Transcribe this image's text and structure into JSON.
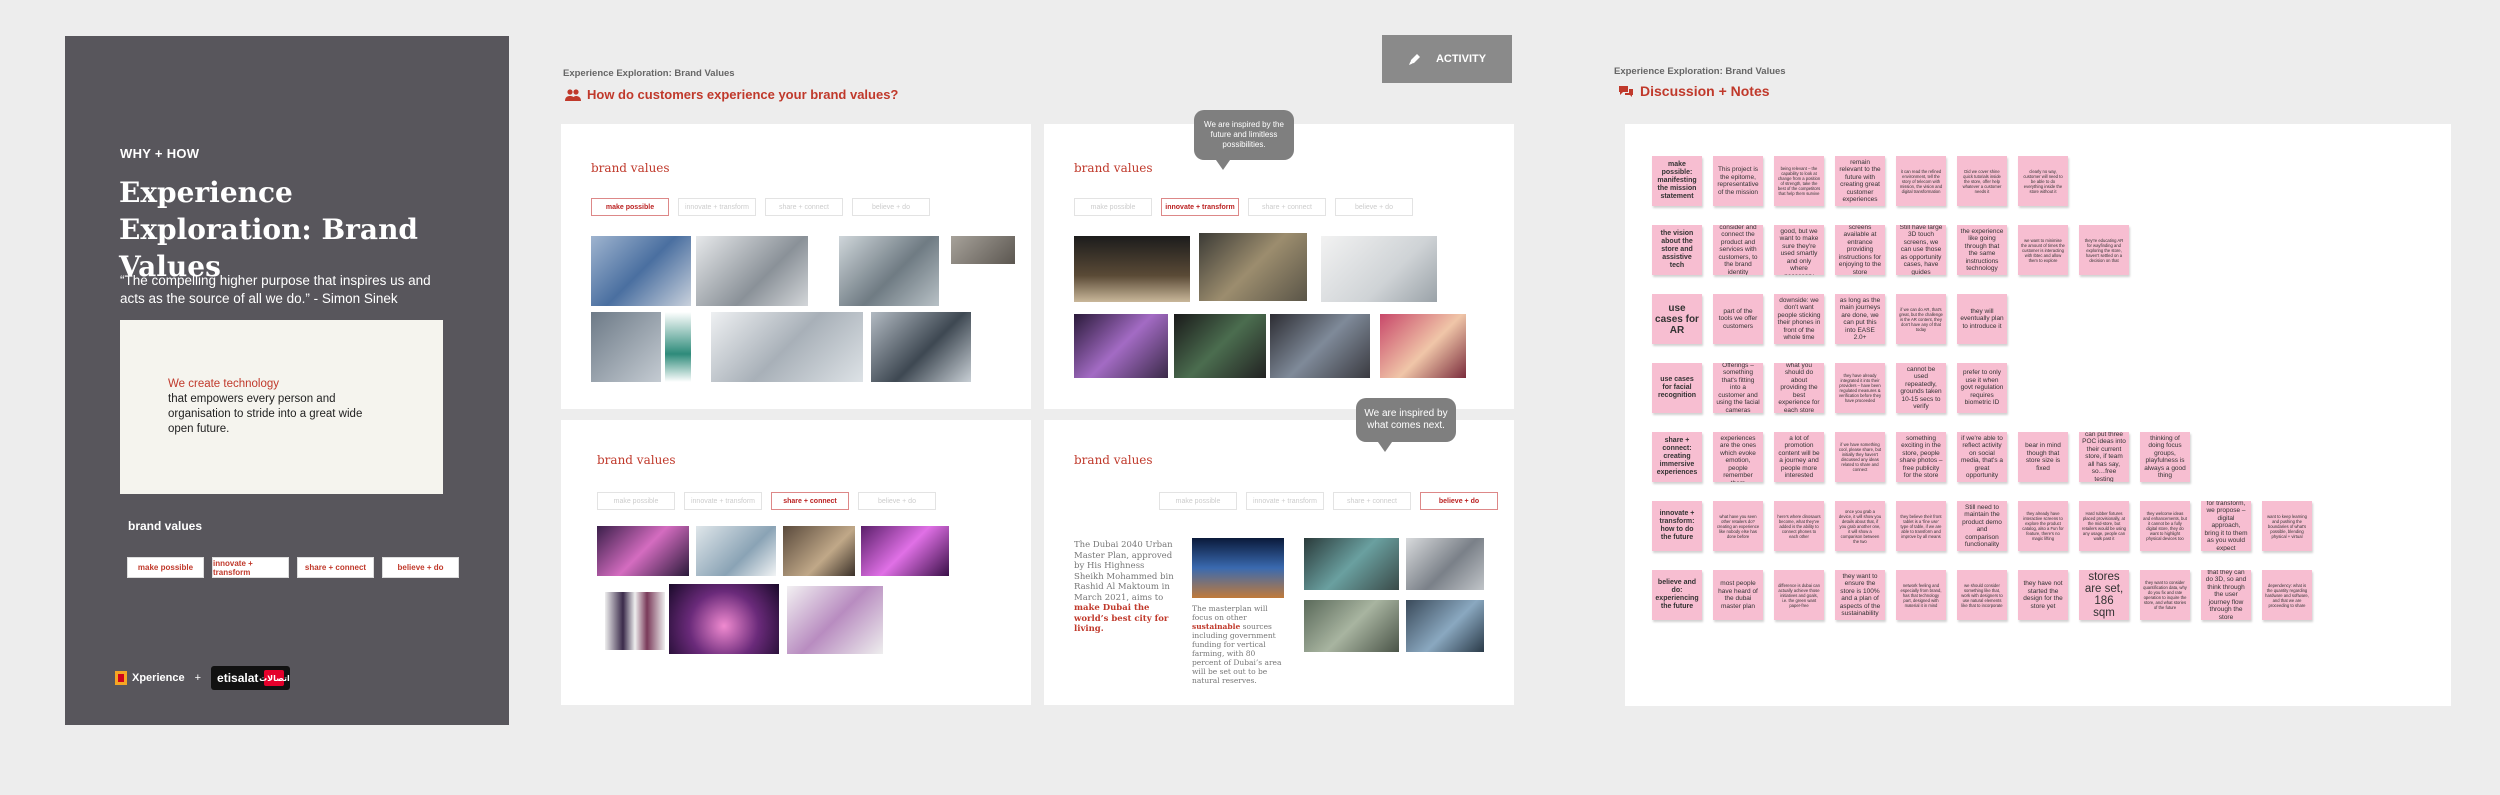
{
  "left_panel": {
    "eyebrow": "WHY + HOW",
    "title": "Experience Exploration: Brand Values",
    "quote": "“The compelling higher purpose that inspires us and acts as the source of all we do.” - Simon Sinek",
    "card_highlight": "We create technology",
    "card_text": "that empowers every person and organisation to stride into a great wide open future.",
    "brand_values_label": "brand values",
    "pills": [
      "make possible",
      "innovate + transform",
      "share + connect",
      "believe + do"
    ],
    "logo_xperience": "Xperience",
    "logo_plus": "+",
    "logo_etisalat": "etisalat",
    "logo_etisalat_ar": "اتصالات"
  },
  "middle": {
    "crumb": "Experience Exploration: Brand Values",
    "heading": "How do customers experience your brand values?",
    "activity_label": "ACTIVITY",
    "card_title": "brand values",
    "pills": [
      "make possible",
      "innovate + transform",
      "share + connect",
      "believe + do"
    ],
    "tooltip_1": "We are inspired by the future and limitless possibilities.",
    "tooltip_2": "We are inspired by what comes next.",
    "text_a_pre": "The Dubai 2040 Urban Master Plan, approved by His Highness Sheikh Mohammed bin Rashid Al Maktoum in March 2021, aims to ",
    "text_a_hl": "make Dubai the world’s best city for living.",
    "text_b_pre": "The masterplan will focus on other ",
    "text_b_hl": "sustainable",
    "text_b_post": " sources including government funding for vertical farming, with 80 percent of Dubai’s area will be set out to be natural reserves."
  },
  "right": {
    "crumb": "Experience Exploration: Brand Values",
    "heading": "Discussion + Notes"
  },
  "board": {
    "rows": [
      {
        "label": "make possible: manifesting the mission statement",
        "notes": [
          "This project is the epitome, representative of the mission",
          "being relevant – the capability to look at change from a position of strength, take the best of the competitors that help them survive",
          "remain relevant to the future with creating great customer experiences",
          "it can read the refined environment, tell the story of telecom with mission, the vision and digital transformation",
          "Did we cover shine quick tutorials inside the store, offer help whatever a customer needs it",
          "clearly no way, customer will need to be able to do everything inside the store without it"
        ]
      },
      {
        "label": "the vision about the store and assistive tech",
        "notes": [
          "consider and connect the product and services with customers, to the brand identity",
          "screens are good, but we want to make sure they're used smartly and only where necessary",
          "screens available at entrance providing instructions for enjoying to the store",
          "Still have large 3D touch screens, we can use those as opportunity cases, have guides",
          "the experience like going through that the same instructions technology",
          "we want to minimise the amount of times the customer is interacting with Ibtec and allow them to explore",
          "they're educating AR for wayfinding and exploring the store, haven't settled on a decision on that"
        ]
      },
      {
        "label": "use cases for AR",
        "notes": [
          "part of the tools we offer customers",
          "downside: we don't want people sticking their phones in front of the whole time",
          "as long as the main journeys are done, we can put this into EASE 2.0+",
          "if we can do AR, that's great, but the challenge is the AR content, they don't have any of that today",
          "they will eventually plan to introduce it"
        ]
      },
      {
        "label": "use cases for facial recognition",
        "notes": [
          "Offerings – something that's fitting into a customer and using the facial cameras",
          "what you should do about providing the best experience for each store",
          "they have already integrated it into their providers – have been regulated measures & verification before they have proceeded",
          "cannot be used repeatedly, grounds taken 10-15 secs to verify",
          "prefer to only use it when govt regulation requires biometric ID"
        ]
      },
      {
        "label": "share + connect: creating immersive experiences",
        "notes": [
          "immersive experiences are the ones which evoke emotion, people remember them",
          "a lot of promotion content will be a journey and people more interested",
          "if we have something cool, please share, but initially they haven't discussed any ideas related to share and connect",
          "something exciting in the store, people share photos – free publicity for the store",
          "if we're able to reflect activity on social media, that's a great opportunity",
          "bear in mind though that store size is fixed",
          "can put three POC ideas into their current store, if team all has say, so…free testing",
          "thinking of doing focus groups, playfulness is always a good thing"
        ]
      },
      {
        "label": "innovate + transform: how to do the future",
        "notes": [
          "what have you seen other retailers do? creating an experience like nobody else has done before",
          "here's where dinosaurs become, what they've added is the ability to connect phones to each other",
          "once you grab a device, it will show you details about that, if you grab another one, it will show a comparison between the two",
          "they believe their front tablet is a 'fine use' type of table, if we are able to transform and improve by all means",
          "Still need to maintain the product demo and comparison functionality",
          "they already have interactive screens to explore the product catalog, also a Fun for feature, there's no magic lifting",
          "Hard rubber fixtures placed provisionally, at the mid-store, but retailers would be using any usage, people can walk past it",
          "they welcome ideas and enhancements, but it cannot be a fully digital store, they do want to highlight physical devices too",
          "for transform, we propose – digital approach, bring it to them as you would expect",
          "want to keep learning and pushing the boundaries of what's possible, blending physical + virtual"
        ]
      },
      {
        "label": "believe and do: experiencing the future",
        "notes": [
          "most people have heard of the dubai master plan",
          "difference is dubai can actually achieve those initiatives and goals, i.e. the green want paper-free",
          "they want to ensure the store is 100% and a plan of aspects of the sustainability",
          "network feeling and especially from brand, has that technology part, designed with material it in mind",
          "we should consider something like that, work with designers to use natural elements like that to incorporate",
          "they have not started the design for the store yet",
          "stores are set, 186 sqm",
          "they want to consider quantification data, why do you fix and rate operation to inquire the store, and what stories of the future",
          "that they can do 3D, so and think through the user journey flow through the store",
          "dependency: what is the quantity regarding hardware and software, and that we are proceeding to share"
        ]
      }
    ]
  }
}
